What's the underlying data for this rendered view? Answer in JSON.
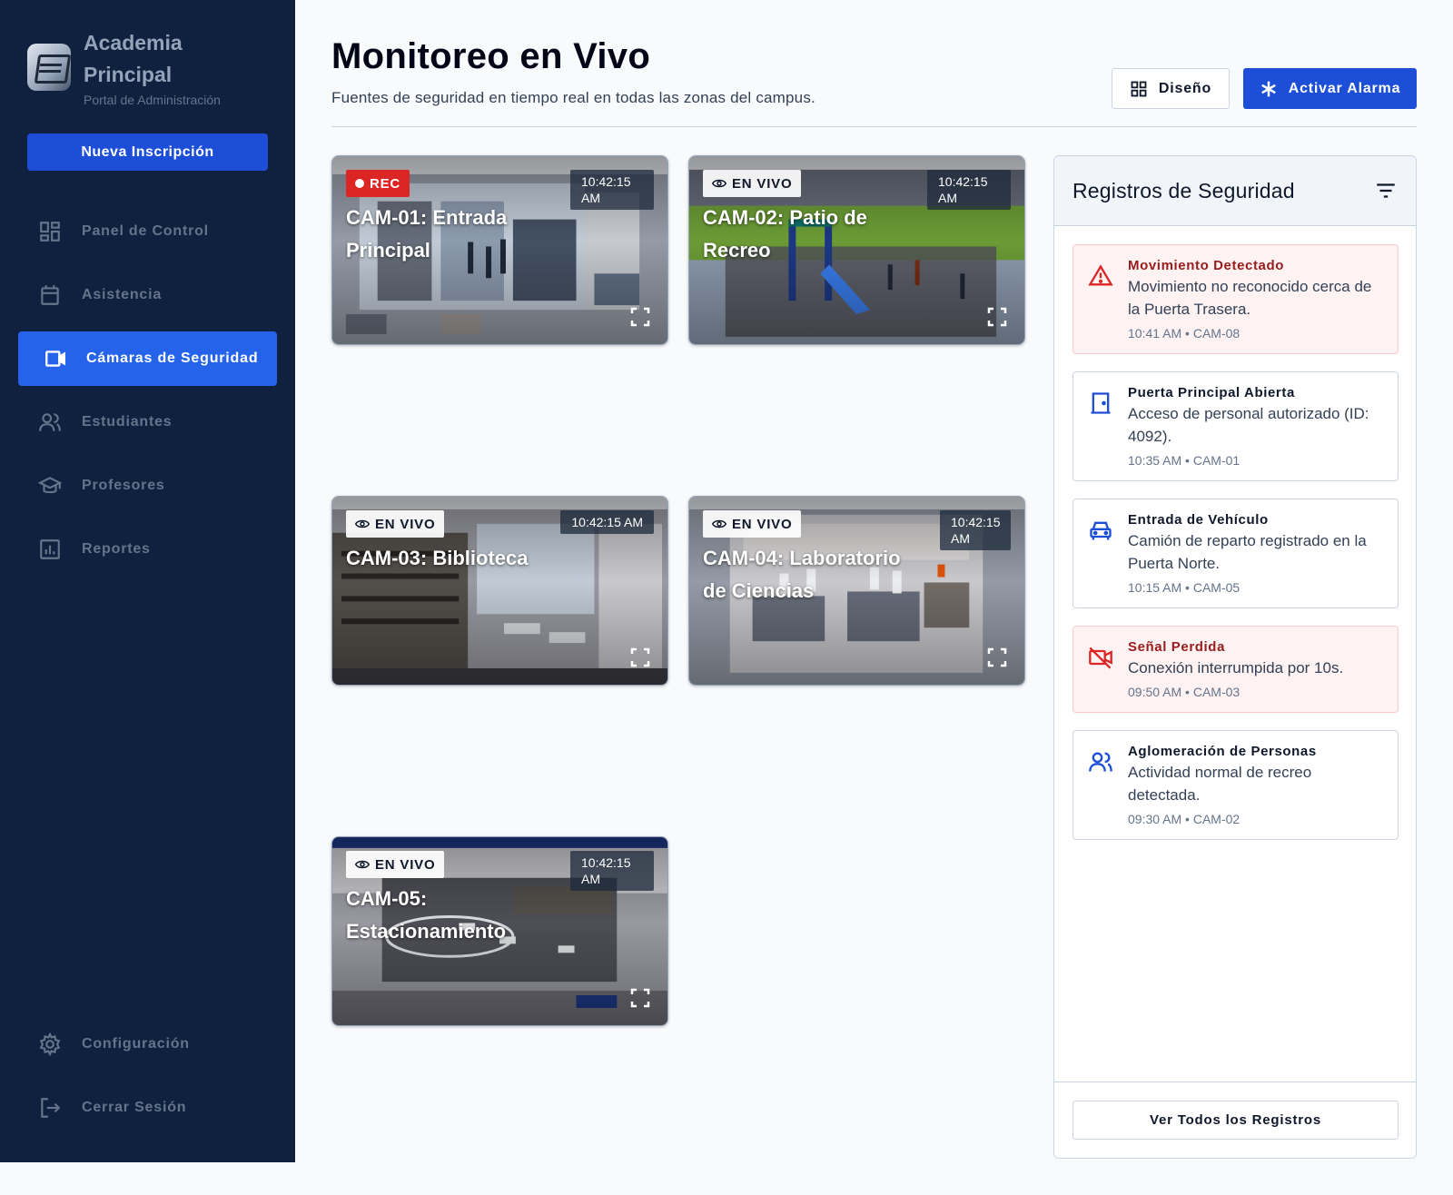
{
  "brand": {
    "name": "Academia Principal",
    "subtitle": "Portal de Administración"
  },
  "sidebar": {
    "cta_label": "Nueva Inscripción",
    "items": [
      {
        "label": "Panel de Control",
        "icon": "dashboard-icon",
        "active": false
      },
      {
        "label": "Asistencia",
        "icon": "calendar-icon",
        "active": false
      },
      {
        "label": "Cámaras de Seguridad",
        "icon": "video-camera-icon",
        "active": true
      },
      {
        "label": "Estudiantes",
        "icon": "users-icon",
        "active": false
      },
      {
        "label": "Profesores",
        "icon": "graduation-cap-icon",
        "active": false
      },
      {
        "label": "Reportes",
        "icon": "bar-chart-icon",
        "active": false
      }
    ],
    "bottom_items": [
      {
        "label": "Configuración",
        "icon": "gear-icon"
      },
      {
        "label": "Cerrar Sesión",
        "icon": "logout-icon"
      }
    ]
  },
  "header": {
    "title": "Monitoreo en Vivo",
    "subtitle": "Fuentes de seguridad en tiempo real en todas las zonas del campus.",
    "layout_label": "Diseño",
    "alarm_label": "Activar Alarma"
  },
  "cameras": [
    {
      "title": "CAM-01: Entrada Principal",
      "badge": "REC",
      "time": "10:42:15 AM",
      "scene": "entrance"
    },
    {
      "title": "CAM-02: Patio de Recreo",
      "badge": "EN VIVO",
      "time": "10:42:15 AM",
      "scene": "playground"
    },
    {
      "title": "CAM-03: Biblioteca",
      "badge": "EN VIVO",
      "time": "10:42:15 AM",
      "scene": "library"
    },
    {
      "title": "CAM-04: Laboratorio de Ciencias",
      "badge": "EN VIVO",
      "time": "10:42:15 AM",
      "scene": "lab"
    },
    {
      "title": "CAM-05: Estacionamiento",
      "badge": "EN VIVO",
      "time": "10:42:15 AM",
      "scene": "parking"
    }
  ],
  "logs": {
    "title": "Registros de Seguridad",
    "view_all_label": "Ver Todos los Registros",
    "items": [
      {
        "title": "Movimiento Detectado",
        "desc": "Movimiento no reconocido cerca de la Puerta Trasera.",
        "meta": "10:41 AM • CAM-08",
        "icon": "warning-icon",
        "alert": true
      },
      {
        "title": "Puerta Principal Abierta",
        "desc": "Acceso de personal autorizado (ID: 4092).",
        "meta": "10:35 AM • CAM-01",
        "icon": "door-icon",
        "alert": false
      },
      {
        "title": "Entrada de Vehículo",
        "desc": "Camión de reparto registrado en la Puerta Norte.",
        "meta": "10:15 AM • CAM-05",
        "icon": "car-icon",
        "alert": false
      },
      {
        "title": "Señal Perdida",
        "desc": "Conexión interrumpida por 10s.",
        "meta": "09:50 AM • CAM-03",
        "icon": "video-off-icon",
        "alert": true
      },
      {
        "title": "Aglomeración de Personas",
        "desc": "Actividad normal de recreo detectada.",
        "meta": "09:30 AM • CAM-02",
        "icon": "group-icon",
        "alert": false
      }
    ]
  },
  "colors": {
    "sidebar_bg": "#0f213f",
    "accent": "#2563eb",
    "alert_red": "#dc2626",
    "alert_bg": "#fef2f2"
  }
}
